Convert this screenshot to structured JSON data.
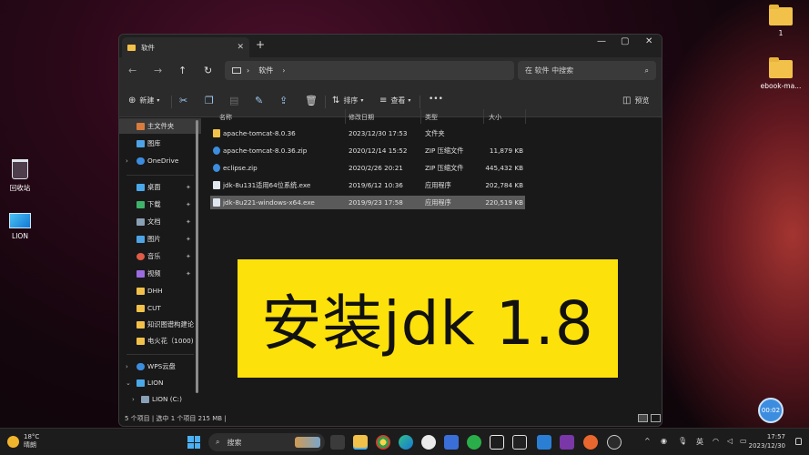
{
  "desktop": {
    "icons": [
      {
        "label": "1",
        "icon": "folder-icon"
      },
      {
        "label": "ebook-ma...",
        "icon": "folder-icon"
      },
      {
        "label": "回收站",
        "icon": "recycle-bin-icon"
      },
      {
        "label": "LION",
        "icon": "this-pc-icon"
      }
    ]
  },
  "window": {
    "tab_title": "软件",
    "tab_close": "✕",
    "new_tab": "+",
    "controls": {
      "minimize": "—",
      "maximize": "▢",
      "close": "✕"
    },
    "nav": {
      "back": "←",
      "forward": "→",
      "up": "↑",
      "refresh": "↻"
    },
    "address": {
      "location": "软件",
      "chevron": "›"
    },
    "search": {
      "placeholder": "在 软件 中搜索",
      "icon": "⌕"
    },
    "toolbar": {
      "new_label": "新建",
      "sort_label": "排序",
      "view_label": "查看",
      "more": "•••",
      "preview_label": "预览"
    },
    "sidebar": {
      "items": [
        {
          "label": "主文件夹",
          "icon": "home-icon"
        },
        {
          "label": "图库",
          "icon": "gallery-icon"
        },
        {
          "label": "OneDrive",
          "icon": "cloud-icon"
        },
        {
          "label": "桌面",
          "icon": "desktop-icon"
        },
        {
          "label": "下载",
          "icon": "download-icon"
        },
        {
          "label": "文档",
          "icon": "document-icon"
        },
        {
          "label": "图片",
          "icon": "pictures-icon"
        },
        {
          "label": "音乐",
          "icon": "music-icon"
        },
        {
          "label": "视频",
          "icon": "video-icon"
        },
        {
          "label": "DHH",
          "icon": "folder-icon"
        },
        {
          "label": "CUT",
          "icon": "folder-icon"
        },
        {
          "label": "知识图谱构建论",
          "icon": "folder-icon"
        },
        {
          "label": "电火花（1000)",
          "icon": "folder-icon"
        },
        {
          "label": "WPS云盘",
          "icon": "cloud-icon"
        },
        {
          "label": "LION",
          "icon": "this-pc-icon"
        },
        {
          "label": "LION (C:)",
          "icon": "drive-icon"
        }
      ]
    },
    "columns": [
      "名称",
      "修改日期",
      "类型",
      "大小"
    ],
    "files": [
      {
        "name": "apache-tomcat-8.0.36",
        "date": "2023/12/30 17:53",
        "type": "文件夹",
        "size": ""
      },
      {
        "name": "apache-tomcat-8.0.36.zip",
        "date": "2020/12/14 15:52",
        "type": "ZIP 压缩文件",
        "size": "11,879 KB"
      },
      {
        "name": "eclipse.zip",
        "date": "2020/2/26 20:21",
        "type": "ZIP 压缩文件",
        "size": "445,432 KB"
      },
      {
        "name": "jdk-8u131适用64位系统.exe",
        "date": "2019/6/12 10:36",
        "type": "应用程序",
        "size": "202,784 KB"
      },
      {
        "name": "jdk-8u221-windows-x64.exe",
        "date": "2019/9/23 17:58",
        "type": "应用程序",
        "size": "220,519 KB"
      }
    ],
    "status": "5 个项目  |  选中 1 个项目  215 MB  |"
  },
  "banner": {
    "text": "安装jdk 1.8"
  },
  "timer": {
    "text": "00:02"
  },
  "taskbar": {
    "weather_temp": "18°C",
    "weather_desc": "晴朗",
    "search_placeholder": "搜索",
    "tray": {
      "chevron": "^",
      "lang": "英"
    },
    "clock_time": "17:57",
    "clock_date": "2023/12/30"
  }
}
